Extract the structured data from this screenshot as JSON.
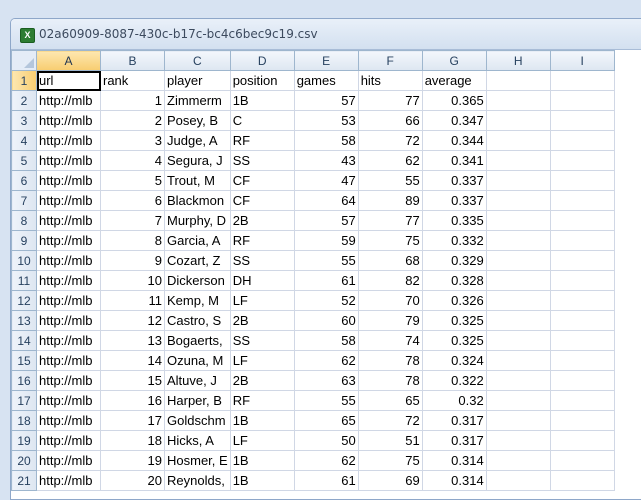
{
  "window": {
    "title": "02a60909-8087-430c-b17c-bc4c6bec9c19.csv",
    "icon": "excel-icon"
  },
  "columns": [
    "A",
    "B",
    "C",
    "D",
    "E",
    "F",
    "G",
    "H",
    "I"
  ],
  "rows": [
    {
      "n": "1",
      "url": "url",
      "rank": "rank",
      "player": "player",
      "position": "position",
      "games": "games",
      "hits": "hits",
      "average": "average"
    },
    {
      "n": "2",
      "url": "http://mlb",
      "rank": "1",
      "player": "Zimmerm",
      "position": "1B",
      "games": "57",
      "hits": "77",
      "average": "0.365"
    },
    {
      "n": "3",
      "url": "http://mlb",
      "rank": "2",
      "player": "Posey, B",
      "position": "C",
      "games": "53",
      "hits": "66",
      "average": "0.347"
    },
    {
      "n": "4",
      "url": "http://mlb",
      "rank": "3",
      "player": "Judge, A",
      "position": "RF",
      "games": "58",
      "hits": "72",
      "average": "0.344"
    },
    {
      "n": "5",
      "url": "http://mlb",
      "rank": "4",
      "player": "Segura, J",
      "position": "SS",
      "games": "43",
      "hits": "62",
      "average": "0.341"
    },
    {
      "n": "6",
      "url": "http://mlb",
      "rank": "5",
      "player": "Trout, M",
      "position": "CF",
      "games": "47",
      "hits": "55",
      "average": "0.337"
    },
    {
      "n": "7",
      "url": "http://mlb",
      "rank": "6",
      "player": "Blackmon",
      "position": "CF",
      "games": "64",
      "hits": "89",
      "average": "0.337"
    },
    {
      "n": "8",
      "url": "http://mlb",
      "rank": "7",
      "player": "Murphy, D",
      "position": "2B",
      "games": "57",
      "hits": "77",
      "average": "0.335"
    },
    {
      "n": "9",
      "url": "http://mlb",
      "rank": "8",
      "player": "Garcia, A",
      "position": "RF",
      "games": "59",
      "hits": "75",
      "average": "0.332"
    },
    {
      "n": "10",
      "url": "http://mlb",
      "rank": "9",
      "player": "Cozart, Z",
      "position": "SS",
      "games": "55",
      "hits": "68",
      "average": "0.329"
    },
    {
      "n": "11",
      "url": "http://mlb",
      "rank": "10",
      "player": "Dickerson",
      "position": "DH",
      "games": "61",
      "hits": "82",
      "average": "0.328"
    },
    {
      "n": "12",
      "url": "http://mlb",
      "rank": "11",
      "player": "Kemp, M",
      "position": "LF",
      "games": "52",
      "hits": "70",
      "average": "0.326"
    },
    {
      "n": "13",
      "url": "http://mlb",
      "rank": "12",
      "player": "Castro, S",
      "position": "2B",
      "games": "60",
      "hits": "79",
      "average": "0.325"
    },
    {
      "n": "14",
      "url": "http://mlb",
      "rank": "13",
      "player": "Bogaerts,",
      "position": "SS",
      "games": "58",
      "hits": "74",
      "average": "0.325"
    },
    {
      "n": "15",
      "url": "http://mlb",
      "rank": "14",
      "player": "Ozuna, M",
      "position": "LF",
      "games": "62",
      "hits": "78",
      "average": "0.324"
    },
    {
      "n": "16",
      "url": "http://mlb",
      "rank": "15",
      "player": "Altuve, J",
      "position": "2B",
      "games": "63",
      "hits": "78",
      "average": "0.322"
    },
    {
      "n": "17",
      "url": "http://mlb",
      "rank": "16",
      "player": "Harper, B",
      "position": "RF",
      "games": "55",
      "hits": "65",
      "average": "0.32"
    },
    {
      "n": "18",
      "url": "http://mlb",
      "rank": "17",
      "player": "Goldschm",
      "position": "1B",
      "games": "65",
      "hits": "72",
      "average": "0.317"
    },
    {
      "n": "19",
      "url": "http://mlb",
      "rank": "18",
      "player": "Hicks, A",
      "position": "LF",
      "games": "50",
      "hits": "51",
      "average": "0.317"
    },
    {
      "n": "20",
      "url": "http://mlb",
      "rank": "19",
      "player": "Hosmer, E",
      "position": "1B",
      "games": "62",
      "hits": "75",
      "average": "0.314"
    },
    {
      "n": "21",
      "url": "http://mlb",
      "rank": "20",
      "player": "Reynolds,",
      "position": "1B",
      "games": "61",
      "hits": "69",
      "average": "0.314"
    }
  ]
}
